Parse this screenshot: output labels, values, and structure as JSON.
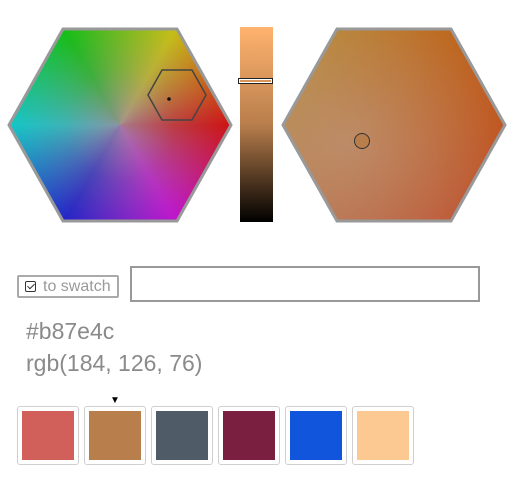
{
  "picker": {
    "hue_hexagon": {
      "indicator_icon": "hexagon-cursor-icon"
    },
    "saturation_hexagon": {
      "base_color": "#b87e4c",
      "indicator_icon": "circle-cursor-icon"
    },
    "lightness_slider": {
      "top_color": "#ffb36e",
      "mid_color": "#b87e4c",
      "bottom_color": "#000000"
    }
  },
  "controls": {
    "to_swatch_label": "to swatch",
    "to_swatch_icon": "checkbox-checked-icon",
    "color_input_value": "",
    "color_input_placeholder": ""
  },
  "readout": {
    "hex": "#b87e4c",
    "rgb": "rgb(184, 126, 76)"
  },
  "swatches": {
    "selected_marker": "▼",
    "items": [
      {
        "color": "#d1605a"
      },
      {
        "color": "#b87e4c"
      },
      {
        "color": "#4f5c68"
      },
      {
        "color": "#7b1f40"
      },
      {
        "color": "#1155dd"
      },
      {
        "color": "#fcc992"
      }
    ]
  }
}
